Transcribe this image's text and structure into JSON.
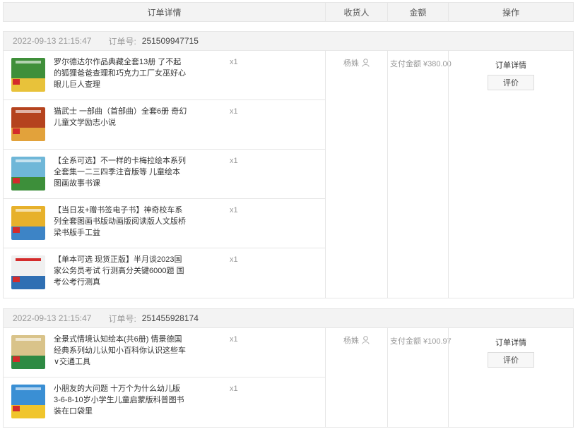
{
  "header": {
    "order_detail": "订单详情",
    "receiver": "收货人",
    "amount": "金额",
    "operation": "操作"
  },
  "orders": [
    {
      "datetime": "2022-09-13 21:15:47",
      "order_no_label": "订单号:",
      "order_no": "251509947715",
      "receiver": "杨姝",
      "amount_label": "支付金额",
      "amount": "¥380.00",
      "detail_link": "订单详情",
      "review_button": "评价",
      "items": [
        {
          "title": "罗尔德达尔作品典藏全套13册 了不起的狐狸爸爸查理和巧克力工厂女巫好心眼儿巨人查理",
          "qty": "x1",
          "colors": [
            "#3f8f3a",
            "#e8c23a"
          ]
        },
        {
          "title": "猫武士 一部曲（首部曲）全套6册 奇幻儿童文学励志小说",
          "qty": "x1",
          "colors": [
            "#b5431e",
            "#e2a23b"
          ]
        },
        {
          "title": "【全系可选】不一样的卡梅拉绘本系列全套集一二三四季注音版等 儿童绘本图画故事书课",
          "qty": "x1",
          "colors": [
            "#6fb7d8",
            "#3d8f3a"
          ]
        },
        {
          "title": "【当日发+赠书签电子书】神奇校车系列全套图画书版动画版阅读版人文版桥梁书版手工益",
          "qty": "x1",
          "colors": [
            "#e7b12b",
            "#3d84c6"
          ]
        },
        {
          "title": "【单本可选 现货正版】半月谈2023国家公务员考试 行测高分关键6000题 国考公考行测真",
          "qty": "x1",
          "colors": [
            "#f0f0f0",
            "#2f6fb3"
          ]
        }
      ]
    },
    {
      "datetime": "2022-09-13 21:15:47",
      "order_no_label": "订单号:",
      "order_no": "251455928174",
      "receiver": "杨姝",
      "amount_label": "支付金额",
      "amount": "¥100.97",
      "detail_link": "订单详情",
      "review_button": "评价",
      "items": [
        {
          "title": "全景式情境认知绘本(共6册) 情景德国经典系列幼儿认知小百科你认识这些车∨交通工具",
          "qty": "x1",
          "colors": [
            "#d9c38a",
            "#2e8a43"
          ]
        },
        {
          "title": "小朋友的大问题 十万个为什么幼儿版 3-6-8-10岁小学生儿童启蒙版科普图书 装在口袋里",
          "qty": "x1",
          "colors": [
            "#3a8fd4",
            "#f0c52c"
          ]
        }
      ]
    }
  ],
  "icons": {
    "user": "user-icon"
  }
}
